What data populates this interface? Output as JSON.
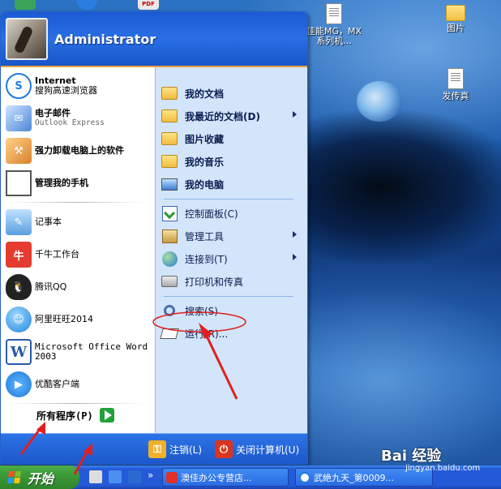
{
  "desktop": {
    "icons": [
      {
        "label_line1": "佳能MG，MX",
        "label_line2": "系列机...",
        "icon": "document-icon"
      },
      {
        "label": "图片",
        "icon": "folder-icon"
      },
      {
        "label": "发传真",
        "icon": "document-icon"
      }
    ],
    "top_sliver_badge": "PDF"
  },
  "start_menu": {
    "username": "Administrator",
    "left_items": [
      {
        "title": "Internet",
        "subtitle": "搜狗高速浏览器",
        "icon": "browser-icon"
      },
      {
        "title": "电子邮件",
        "subtitle": "Outlook Express",
        "icon": "email-icon"
      },
      {
        "title": "强力卸载电脑上的软件",
        "icon": "uninstall-icon"
      },
      {
        "title": "管理我的手机",
        "icon": "phone-manager-icon"
      },
      {
        "title": "记事本",
        "icon": "notepad-icon"
      },
      {
        "title": "千牛工作台",
        "icon": "qianniu-icon"
      },
      {
        "title": "腾讯QQ",
        "icon": "qq-icon"
      },
      {
        "title": "阿里旺旺2014",
        "icon": "aliwangwang-icon"
      },
      {
        "title": "Microsoft Office Word",
        "subtitle": "2003",
        "icon": "word-icon"
      },
      {
        "title": "优酷客户端",
        "icon": "youku-icon"
      }
    ],
    "all_programs": "所有程序(P)",
    "right_items": [
      {
        "label": "我的文档",
        "icon": "folder-icon"
      },
      {
        "label": "我最近的文档(D)",
        "icon": "folder-icon",
        "submenu": true
      },
      {
        "label": "图片收藏",
        "icon": "folder-icon"
      },
      {
        "label": "我的音乐",
        "icon": "folder-icon"
      },
      {
        "label": "我的电脑",
        "icon": "computer-icon"
      },
      {
        "label": "控制面板(C)",
        "icon": "control-panel-icon"
      },
      {
        "label": "管理工具",
        "icon": "admin-tools-icon",
        "submenu": true
      },
      {
        "label": "连接到(T)",
        "icon": "globe-icon",
        "submenu": true
      },
      {
        "label": "打印机和传真",
        "icon": "printer-icon"
      },
      {
        "label": "搜索(S)",
        "icon": "search-icon"
      },
      {
        "label": "运行(R)...",
        "icon": "run-icon"
      }
    ],
    "footer": {
      "logoff": "注销(L)",
      "shutdown": "关闭计算机(U)"
    }
  },
  "taskbar": {
    "start_label": "开始",
    "quick_launch_overflow": "»",
    "tasks": [
      {
        "label": "澳佳办公专营店...",
        "icon": "tmall-icon"
      },
      {
        "label": "武絶九天_第0009...",
        "icon": "browser-icon"
      }
    ]
  },
  "watermark": {
    "brand": "Bai 经验",
    "url": "jingyan.baidu.com"
  },
  "colors": {
    "taskbar": "#245ad6",
    "start_button": "#3b9a38",
    "menu_header": "#1b5ad4",
    "right_column": "#d3e5fa",
    "annotation": "#e02020"
  }
}
